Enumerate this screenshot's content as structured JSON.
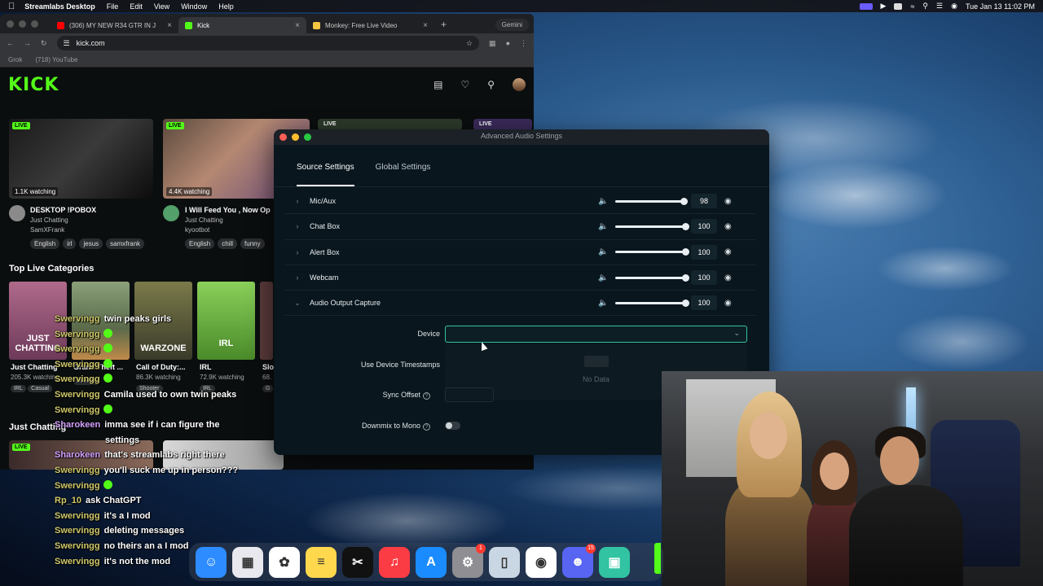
{
  "menubar": {
    "app": "Streamlabs Desktop",
    "items": [
      "File",
      "Edit",
      "View",
      "Window",
      "Help"
    ],
    "clock": "Tue Jan 13  11:02 PM"
  },
  "browser": {
    "tabs": [
      {
        "title": "(306) MY NEW R34 GTR IN J",
        "color": "#ff0000"
      },
      {
        "title": "Kick",
        "color": "#53fc18"
      },
      {
        "title": "Monkey: Free Live Video",
        "color": "#f5c542"
      }
    ],
    "gemini": "Gemini",
    "url": "kick.com",
    "bookmarks": [
      "Grok",
      "(718) YouTube"
    ]
  },
  "kick": {
    "logo": "KICK",
    "streams": [
      {
        "live": "LIVE",
        "watching": "1.1K watching",
        "title": "DESKTOP !POBOX",
        "category": "Just Chatting",
        "user": "SamXFrank",
        "tags": [
          "English",
          "irl",
          "jesus",
          "samxfrank"
        ]
      },
      {
        "live": "LIVE",
        "watching": "4.4K watching",
        "title": "I Will Feed You , Now Op",
        "category": "Just Chatting",
        "user": "kyootbot",
        "tags": [
          "English",
          "chill",
          "funny"
        ]
      },
      {
        "live": "LIVE"
      },
      {
        "live": "LIVE"
      }
    ],
    "top_categories_heading": "Top Live Categories",
    "categories": [
      {
        "art": "JUST CHATTING",
        "name": "Just Chatting",
        "watching": "205.3K watching",
        "tag": "IRL",
        "tag2": "Casual"
      },
      {
        "art": "",
        "name": "Grand Theft ...",
        "watching": "",
        "tag": "Shooter"
      },
      {
        "art": "WARZONE",
        "name": "Call of Duty:...",
        "watching": "86.3K watching",
        "tag": "Shooter"
      },
      {
        "art": "IRL",
        "name": "IRL",
        "watching": "72.9K watching",
        "tag": "IRL"
      },
      {
        "art": "",
        "name": "Slo",
        "watching": "68.",
        "tag": "G"
      }
    ],
    "just_chatting_heading": "Just Chatting",
    "bottom_live": "LIVE"
  },
  "chat": [
    {
      "user": "Swervingg",
      "msg": "twin peaks girls",
      "emote": false,
      "purple": false
    },
    {
      "user": "Swervingg",
      "msg": "",
      "emote": true,
      "purple": false
    },
    {
      "user": "Swervingg",
      "msg": "",
      "emote": true,
      "purple": false
    },
    {
      "user": "Swervingg",
      "msg": "",
      "emote": true,
      "purple": false
    },
    {
      "user": "Swervingg",
      "msg": "",
      "emote": true,
      "purple": false
    },
    {
      "user": "Swervingg",
      "msg": "Camila used to own twin peaks",
      "emote": false,
      "purple": false
    },
    {
      "user": "Swervingg",
      "msg": "",
      "emote": true,
      "purple": false
    },
    {
      "user": "Sharokeen",
      "msg": "imma see if i can figure the",
      "emote": false,
      "purple": true
    },
    {
      "user": "",
      "msg": "settings",
      "emote": false,
      "purple": false
    },
    {
      "user": "Sharokeen",
      "msg": "that's streamlabs right there",
      "emote": false,
      "purple": true
    },
    {
      "user": "Swervingg",
      "msg": "you'll suck me up in person???",
      "emote": false,
      "purple": false
    },
    {
      "user": "Swervingg",
      "msg": "",
      "emote": true,
      "purple": false
    },
    {
      "user": "Rp_10",
      "msg": "ask ChatGPT",
      "emote": false,
      "purple": false
    },
    {
      "user": "Swervingg",
      "msg": "it's a I mod",
      "emote": false,
      "purple": false
    },
    {
      "user": "Swervingg",
      "msg": "deleting messages",
      "emote": false,
      "purple": false
    },
    {
      "user": "Swervingg",
      "msg": "no theirs an a I mod",
      "emote": false,
      "purple": false
    },
    {
      "user": "Swervingg",
      "msg": "it's not the mod",
      "emote": false,
      "purple": false
    }
  ],
  "dialog": {
    "title": "Advanced Audio Settings",
    "tabs": [
      "Source Settings",
      "Global Settings"
    ],
    "sources": [
      {
        "name": "Mic/Aux",
        "volume": "98",
        "expanded": false
      },
      {
        "name": "Chat Box",
        "volume": "100",
        "expanded": false
      },
      {
        "name": "Alert Box",
        "volume": "100",
        "expanded": false
      },
      {
        "name": "Webcam",
        "volume": "100",
        "expanded": false
      },
      {
        "name": "Audio Output Capture",
        "volume": "100",
        "expanded": true
      }
    ],
    "device_label": "Device",
    "device_value": "",
    "no_data": "No Data",
    "timestamps_label": "Use Device Timestamps",
    "sync_label": "Sync Offset",
    "downmix_label": "Downmix to Mono"
  },
  "dock": [
    {
      "name": "finder",
      "glyph": "☺",
      "color": "#2d8cff"
    },
    {
      "name": "launchpad",
      "glyph": "▦",
      "color": "#e8e8ee"
    },
    {
      "name": "photos",
      "glyph": "✿",
      "color": "#ffffff"
    },
    {
      "name": "notes",
      "glyph": "≡",
      "color": "#ffd84d"
    },
    {
      "name": "capcut",
      "glyph": "✂",
      "color": "#111111"
    },
    {
      "name": "music",
      "glyph": "♫",
      "color": "#fc3c44"
    },
    {
      "name": "app-store",
      "glyph": "A",
      "color": "#1a8cff"
    },
    {
      "name": "settings",
      "glyph": "⚙",
      "color": "#8e8e93",
      "badge": "1"
    },
    {
      "name": "iphone-mirroring",
      "glyph": "▯",
      "color": "#c9d6e3"
    },
    {
      "name": "chrome",
      "glyph": "◉",
      "color": "#ffffff"
    },
    {
      "name": "discord",
      "glyph": "☻",
      "color": "#5865f2",
      "badge": "15"
    },
    {
      "name": "streamlabs",
      "glyph": "▣",
      "color": "#31c3a2"
    }
  ]
}
